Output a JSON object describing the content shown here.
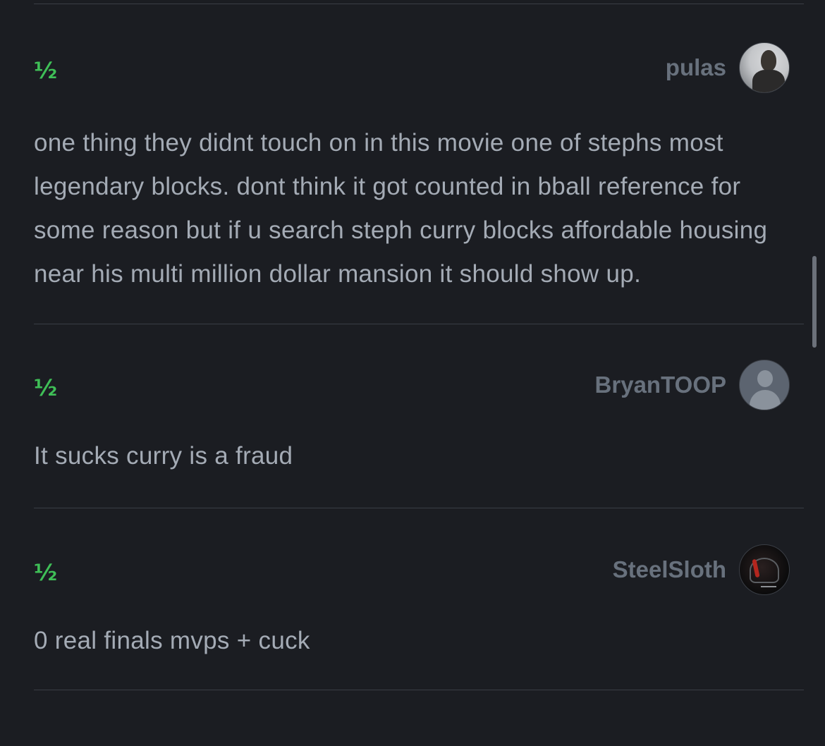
{
  "reviews": [
    {
      "rating": "½",
      "username": "pulas",
      "avatar": "user-photo",
      "text": "one thing they didnt touch on in this movie one of stephs most legendary blocks. dont think it got counted in bball reference for some reason but if u search steph curry blocks affordable housing near his multi million dollar mansion it should show up."
    },
    {
      "rating": "½",
      "username": "BryanTOOP",
      "avatar": "default-avatar",
      "text": "It sucks curry is a fraud"
    },
    {
      "rating": "½",
      "username": "SteelSloth",
      "avatar": "dark-helmet-photo",
      "text": "0 real finals mvps + cuck"
    }
  ],
  "colors": {
    "background": "#1b1d22",
    "rating_green": "#3fbf57",
    "username": "#68717d",
    "body_text": "#a4abb5",
    "divider": "#3a3e45"
  }
}
